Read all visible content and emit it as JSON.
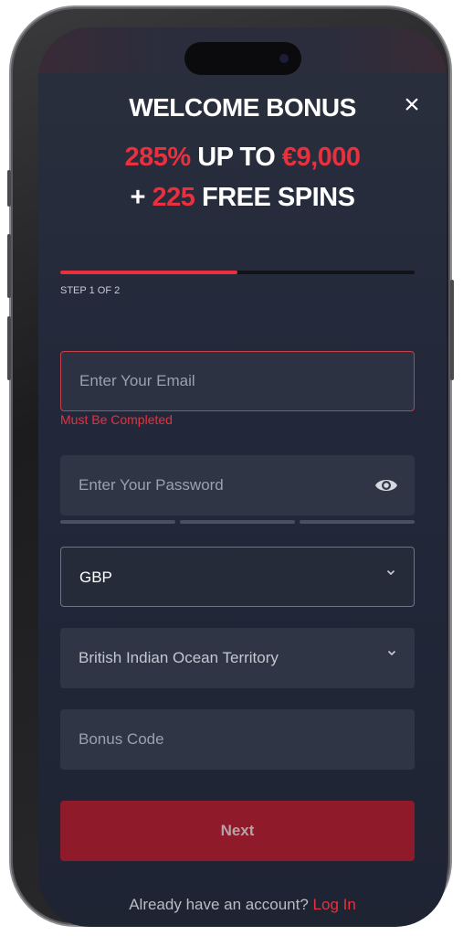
{
  "modal": {
    "title": "WELCOME BONUS",
    "close_icon": "×",
    "promo": {
      "percent": "285%",
      "up_to": "UP TO",
      "amount": "€9,000",
      "plus": "+",
      "spins": "225",
      "spins_label": "FREE SPINS"
    }
  },
  "progress": {
    "step_label": "STEP 1 OF 2",
    "fraction": 0.5
  },
  "form": {
    "email": {
      "placeholder": "Enter Your Email",
      "error": "Must Be Completed"
    },
    "password": {
      "placeholder": "Enter Your Password"
    },
    "currency": {
      "value": "GBP"
    },
    "country": {
      "value": "British Indian Ocean Territory"
    },
    "bonus_code": {
      "placeholder": "Bonus Code"
    },
    "next_label": "Next"
  },
  "footer": {
    "prompt": "Already have an account?",
    "login_link": "Log In"
  },
  "colors": {
    "accent": "#e8303f",
    "button": "#8f1a2a",
    "background": "#22283a"
  }
}
